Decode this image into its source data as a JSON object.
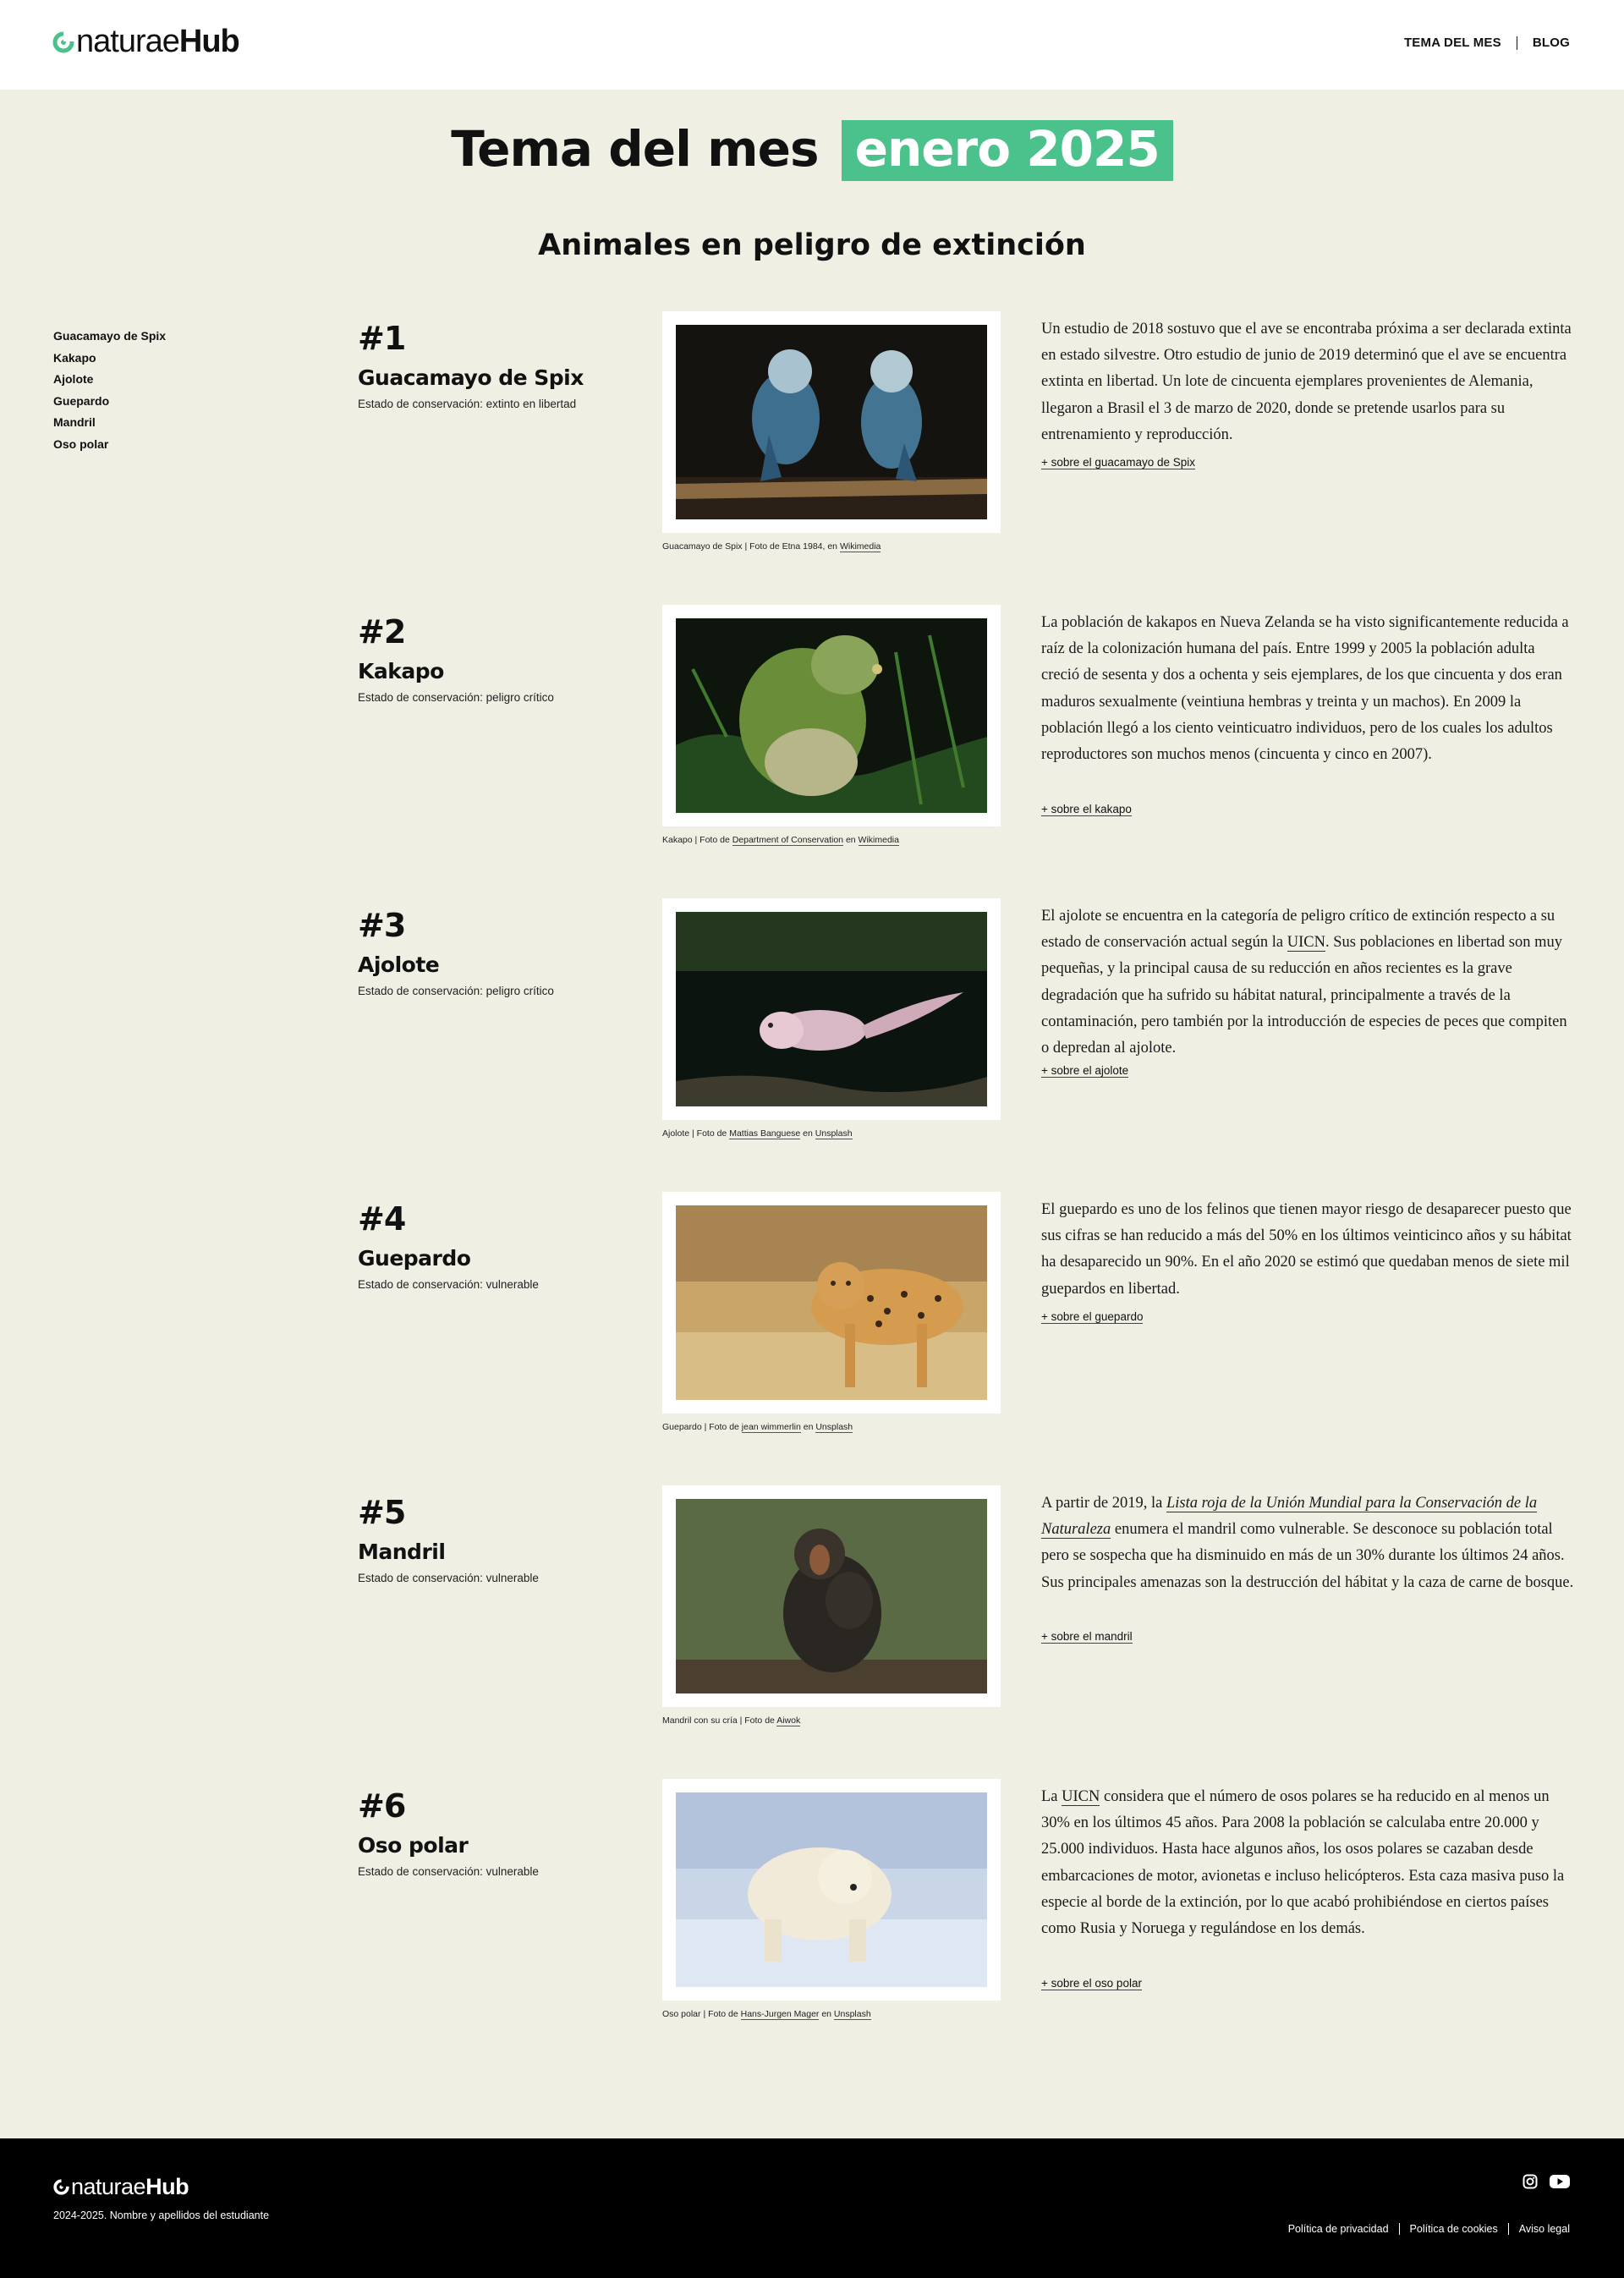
{
  "header": {
    "logo": {
      "part1": "naturae",
      "part2": "Hub"
    },
    "nav": [
      {
        "label": "TEMA DEL MES"
      },
      {
        "label": "BLOG"
      }
    ]
  },
  "hero": {
    "title": "Tema del mes",
    "highlight": "enero 2025",
    "subtitle": "Animales en peligro de extinción"
  },
  "sidebar": {
    "items": [
      {
        "label": "Guacamayo de Spix"
      },
      {
        "label": "Kakapo"
      },
      {
        "label": "Ajolote"
      },
      {
        "label": "Guepardo"
      },
      {
        "label": "Mandril"
      },
      {
        "label": "Oso polar"
      }
    ]
  },
  "entries": [
    {
      "num": "#1",
      "name": "Guacamayo de Spix",
      "status": "Estado de conservación: extinto en libertad",
      "caption": {
        "a": "Guacamayo de Spix | Foto de Etna 1984, en ",
        "link1": "Wikimedia"
      },
      "desc": "Un estudio de 2018 sostuvo que el ave se encontraba próxima a ser declarada extinta en estado silvestre. Otro estudio de junio de 2019 determinó que el ave se encuentra extinta en libertad. Un lote de cincuenta ejemplares provenientes de Alemania, llegaron a Brasil el 3 de marzo de 2020, donde se pretende usarlos para su entrenamiento y reproducción.",
      "more": "+ sobre el guacamayo de Spix"
    },
    {
      "num": "#2",
      "name": "Kakapo",
      "status": "Estado de conservación: peligro crítico",
      "caption": {
        "a": "Kakapo | Foto de ",
        "link1": "Department of Conservation",
        "b": " en ",
        "link2": "Wikimedia"
      },
      "desc": "La población de kakapos en Nueva Zelanda se ha visto significantemente reducida a raíz de la colonización humana del país. Entre 1999 y 2005 la población adulta creció de sesenta y dos a ochenta y seis ejemplares, de los que cincuenta y dos eran maduros sexualmente (veintiuna hembras y treinta y un machos). En 2009 la población llegó a los ciento veinticuatro individuos, pero de los cuales los adultos reproductores son muchos menos (cincuenta y cinco en 2007).",
      "more": "+ sobre el kakapo"
    },
    {
      "num": "#3",
      "name": "Ajolote",
      "status": "Estado de conservación: peligro crítico",
      "caption": {
        "a": "Ajolote | Foto de ",
        "link1": "Mattias Banguese",
        "b": " en ",
        "link2": "Unsplash"
      },
      "desc_a": "El ajolote se encuentra en la categoría de peligro crítico de extinción respecto a su estado de conservación actual según la ",
      "desc_link": "UICN",
      "desc_b": ". Sus poblaciones en libertad son muy pequeñas, y la principal causa de su reducción en años recientes es la grave degradación que ha sufrido su hábitat natural, principalmente a través de la contaminación, pero también por la introducción de especies de peces que compiten o depredan al ajolote.",
      "more": "+ sobre el ajolote"
    },
    {
      "num": "#4",
      "name": "Guepardo",
      "status": "Estado de conservación: vulnerable",
      "caption": {
        "a": "Guepardo | Foto de ",
        "link1": "jean wimmerlin",
        "b": " en ",
        "link2": "Unsplash"
      },
      "desc": "El guepardo es uno de los felinos que tienen mayor riesgo de desaparecer puesto que sus cifras se han reducido a más del 50% en los últimos veinticinco años y su hábitat ha desaparecido un 90%. En el año 2020 se estimó que quedaban menos de siete mil guepardos en libertad.",
      "more": "+ sobre el guepardo"
    },
    {
      "num": "#5",
      "name": "Mandril",
      "status": "Estado de conservación: vulnerable",
      "caption": {
        "a": "Mandril con su cría | Foto de ",
        "link1": "Aiwok"
      },
      "desc_a": "A partir de 2019, la ",
      "desc_link": "Lista roja de la Unión Mundial para la Conservación de la Naturaleza",
      "desc_b": " enumera el mandril como vulnerable. Se desconoce su población total pero se sospecha que ha disminuido en más de un 30% durante los últimos 24 años. Sus principales amenazas son la destrucción del hábitat y la caza de carne de bosque.",
      "more": "+ sobre el mandril"
    },
    {
      "num": "#6",
      "name": "Oso polar",
      "status": "Estado de conservación: vulnerable",
      "caption": {
        "a": "Oso polar | Foto de ",
        "link1": "Hans-Jurgen Mager",
        "b": " en ",
        "link2": "Unsplash"
      },
      "desc_a": "La ",
      "desc_link": "UICN",
      "desc_b": " considera que el número de osos polares se ha reducido en al menos un 30% en los últimos 45 años. Para 2008 la población se calculaba entre 20.000 y 25.000 individuos. Hasta hace algunos años, los osos polares se cazaban desde embarcaciones de motor, avionetas e incluso helicópteros. Esta caza masiva puso la especie al borde de la extinción, por lo que acabó prohibiéndose en ciertos países como Rusia y Noruega y regulándose en los demás.",
      "more": "+ sobre el oso polar"
    }
  ],
  "footer": {
    "logo": {
      "part1": "naturae",
      "part2": "Hub"
    },
    "copyright": "2024-2025. Nombre y apellidos del estudiante",
    "links": [
      {
        "label": "Política de privacidad"
      },
      {
        "label": "Política de cookies"
      },
      {
        "label": "Aviso legal"
      }
    ],
    "social": [
      {
        "icon": "instagram-icon"
      },
      {
        "icon": "youtube-icon"
      }
    ]
  },
  "colors": {
    "accent": "#4bc28c",
    "background": "#f0efe4",
    "footer": "#000000"
  }
}
